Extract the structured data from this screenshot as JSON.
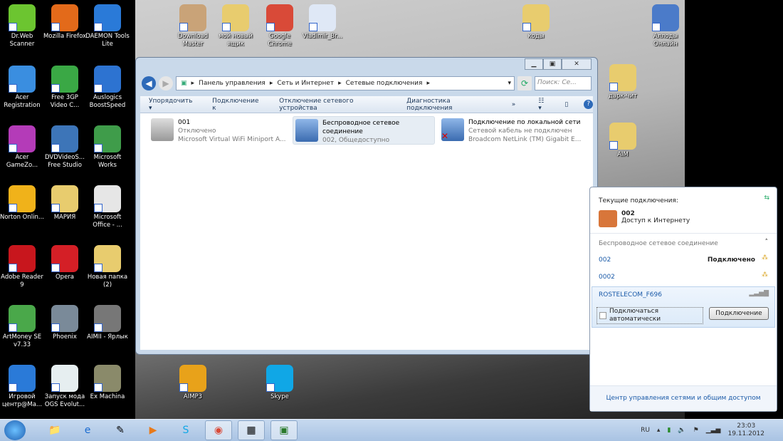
{
  "desktop_icons": [
    {
      "label": "Dr.Web Scanner",
      "color": "#6cc530"
    },
    {
      "label": "Mozilla Firefox",
      "color": "#e36a1a"
    },
    {
      "label": "DAEMON Tools Lite",
      "color": "#2a7ad8"
    },
    {
      "label": "Download Master",
      "color": "#c9a378"
    },
    {
      "label": "мой новый ящик",
      "color": "#e8cc6e"
    },
    {
      "label": "Google Chrome",
      "color": "#d94a38"
    },
    {
      "label": "Vladimir_Br...",
      "color": "#dfe8f6"
    },
    {
      "label": "коды",
      "color": "#e8cc6e"
    },
    {
      "label": "Аллоды Онлайн",
      "color": "#4b7bc9"
    },
    {
      "label": "Acer Registration",
      "color": "#3a8ee0"
    },
    {
      "label": "Free 3GP Video C...",
      "color": "#3aa845"
    },
    {
      "label": "Auslogics BoostSpeed",
      "color": "#2d73d1"
    },
    {
      "label": "дарк-чит",
      "color": "#e8cc6e"
    },
    {
      "label": "Acer GameZo...",
      "color": "#b43bb8"
    },
    {
      "label": "DVDVideoS... Free Studio",
      "color": "#3d75b8"
    },
    {
      "label": "Microsoft Works",
      "color": "#3f9c4a"
    },
    {
      "label": "AIM",
      "color": "#e8cc6e"
    },
    {
      "label": "Norton Onlin...",
      "color": "#f0b21a"
    },
    {
      "label": "МАРИЯ",
      "color": "#e8cc6e"
    },
    {
      "label": "Microsoft Office - ...",
      "color": "#e6e6e6"
    },
    {
      "label": "Adobe Reader 9",
      "color": "#c8161d"
    },
    {
      "label": "Opera",
      "color": "#d41f26"
    },
    {
      "label": "Новая папка (2)",
      "color": "#e8cc6e"
    },
    {
      "label": "ArtMoney SE v7.33",
      "color": "#4aa84a"
    },
    {
      "label": "Phoenix",
      "color": "#7a8a99"
    },
    {
      "label": "AIMII - Ярлык",
      "color": "#777777"
    },
    {
      "label": "Игровой центр@Ma...",
      "color": "#2a7ad8"
    },
    {
      "label": "Запуск мода OGS Evolut...",
      "color": "#e6eef0"
    },
    {
      "label": "Ex Machina",
      "color": "#8a8a6a"
    },
    {
      "label": "AIMP3",
      "color": "#e8a21a"
    },
    {
      "label": "Skype",
      "color": "#10a7e6"
    }
  ],
  "window": {
    "breadcrumb": [
      "Панель управления",
      "Сеть и Интернет",
      "Сетевые подключения"
    ],
    "search_placeholder": "Поиск: Се...",
    "toolbar": [
      "Упорядочить ▾",
      "Подключение к",
      "Отключение сетевого устройства",
      "Диагностика подключения",
      "»"
    ],
    "connections": [
      {
        "name": "001",
        "status": "Отключено",
        "device": "Microsoft Virtual WiFi Miniport A..."
      },
      {
        "name": "Беспроводное сетевое",
        "name2": "соединение",
        "device": "002, Общедоступно"
      },
      {
        "name": "Подключение по локальной сети",
        "status": "Сетевой кабель не подключен",
        "device": "Broadcom NetLink (TM) Gigabit E..."
      }
    ]
  },
  "flyout": {
    "title": "Текущие подключения:",
    "current_name": "002",
    "current_status": "Доступ к Интернету",
    "section": "Беспроводное сетевое соединение",
    "networks": [
      {
        "name": "002",
        "status": "Подключено"
      },
      {
        "name": "0002"
      }
    ],
    "selected_network": "ROSTELECOM_F696",
    "auto_connect_label": "Подключаться автоматически",
    "auto_connect_checked": false,
    "connect_button": "Подключение",
    "footer_link": "Центр управления сетями и общим доступом"
  },
  "taskbar": {
    "lang": "RU",
    "time": "23:03",
    "date": "19.11.2012"
  }
}
